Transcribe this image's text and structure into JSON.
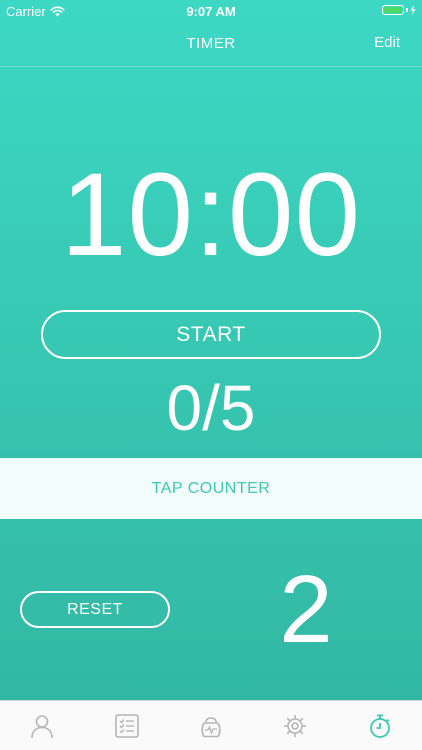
{
  "status_bar": {
    "carrier": "Carrier",
    "time": "9:07 AM",
    "battery_icon": "battery-icon",
    "wifi_icon": "wifi-icon"
  },
  "nav": {
    "title": "TIMER",
    "edit_label": "Edit"
  },
  "timer": {
    "display": "10:00",
    "start_label": "START",
    "rounds": "0/5"
  },
  "tap_counter": {
    "label": "TAP COUNTER",
    "reset_label": "RESET",
    "count": "2"
  },
  "tab_bar": {
    "items": [
      {
        "icon": "profile-icon",
        "active": false
      },
      {
        "icon": "checklist-icon",
        "active": false
      },
      {
        "icon": "kettlebell-icon",
        "active": false
      },
      {
        "icon": "gear-icon",
        "active": false
      },
      {
        "icon": "stopwatch-icon",
        "active": true
      }
    ]
  },
  "colors": {
    "accent": "#3cc8b4",
    "inactive_icon": "#b5b5b5",
    "tab_bar_background": "#fafafa",
    "battery_fill": "#4cd964"
  }
}
